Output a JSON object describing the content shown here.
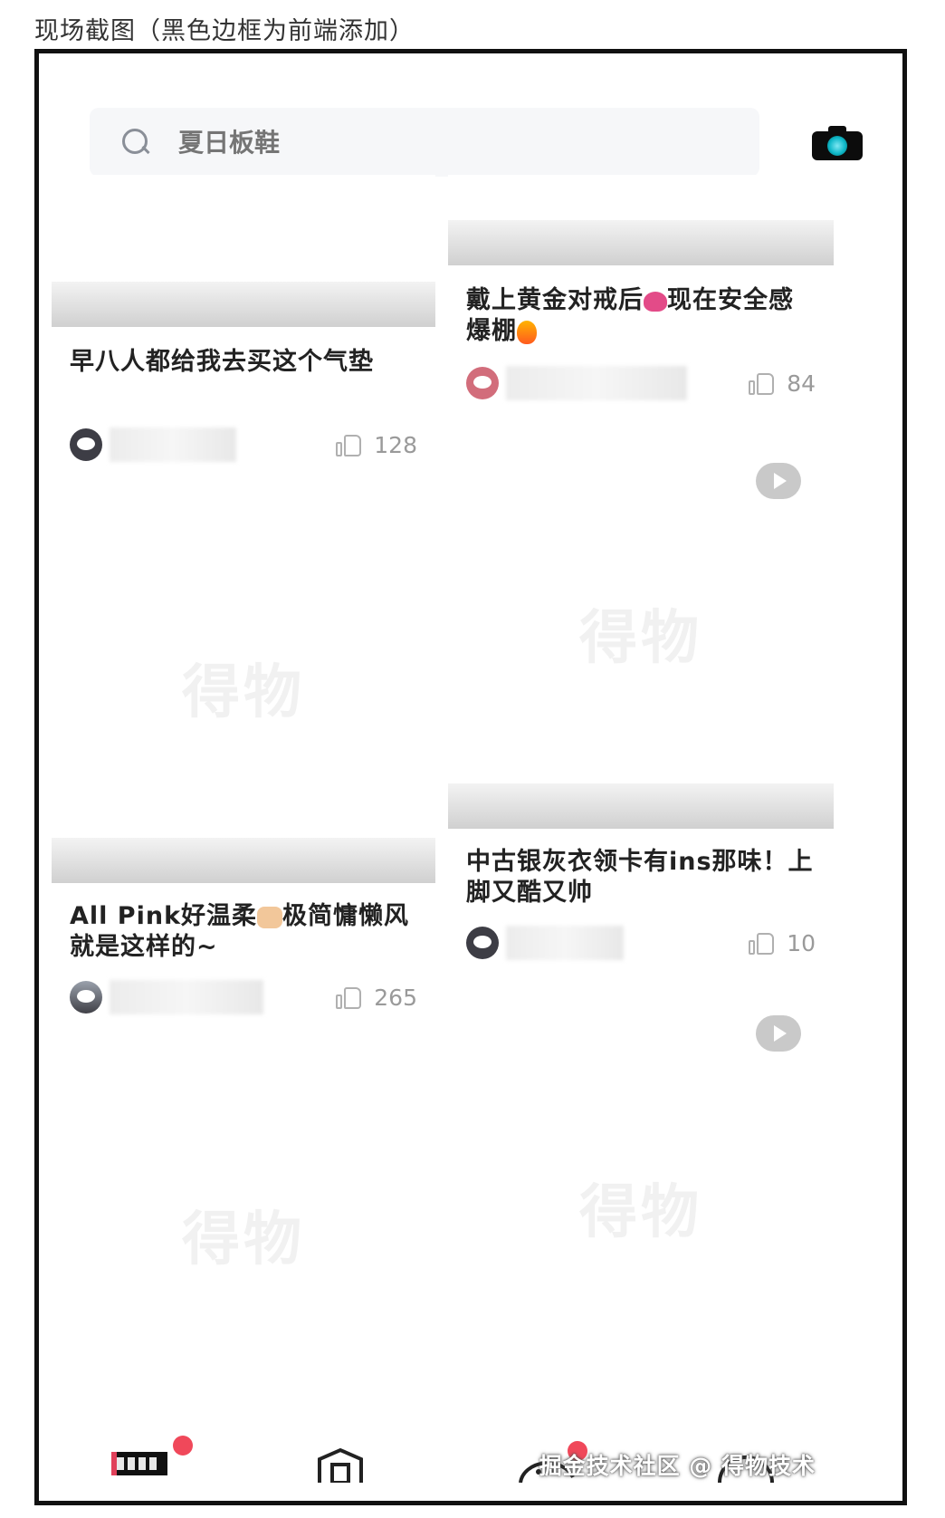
{
  "caption": "现场截图（黑色边框为前端添加）",
  "search": {
    "placeholder": "夏日板鞋"
  },
  "icons": {
    "camera": "camera-icon",
    "search": "search-icon",
    "like": "thumbs-up-icon",
    "play": "play-icon"
  },
  "image_watermark": "得物",
  "feed": {
    "left": [
      {
        "title": "早八人都给我去买这个气垫",
        "likes": "128"
      },
      {
        "title_parts": [
          "All Pink好温柔",
          "极简慵懒风就是这样的~"
        ],
        "likes": "265"
      }
    ],
    "right": [
      {
        "title_parts": [
          "戴上黄金对戒后",
          "现在安全感爆棚"
        ],
        "likes": "84"
      },
      {
        "title": "中古银灰衣领卡有ins那味！上脚又酷又帅",
        "likes": "10"
      }
    ]
  },
  "tabbar": {
    "items": [
      "home-tab",
      "shop-tab",
      "message-tab",
      "profile-tab"
    ]
  },
  "corner_watermark": "掘金技术社区 @ 得物技术",
  "colors": {
    "badge": "#f0485a",
    "frame": "#111111",
    "camera_lens": "#0fb8c9"
  }
}
